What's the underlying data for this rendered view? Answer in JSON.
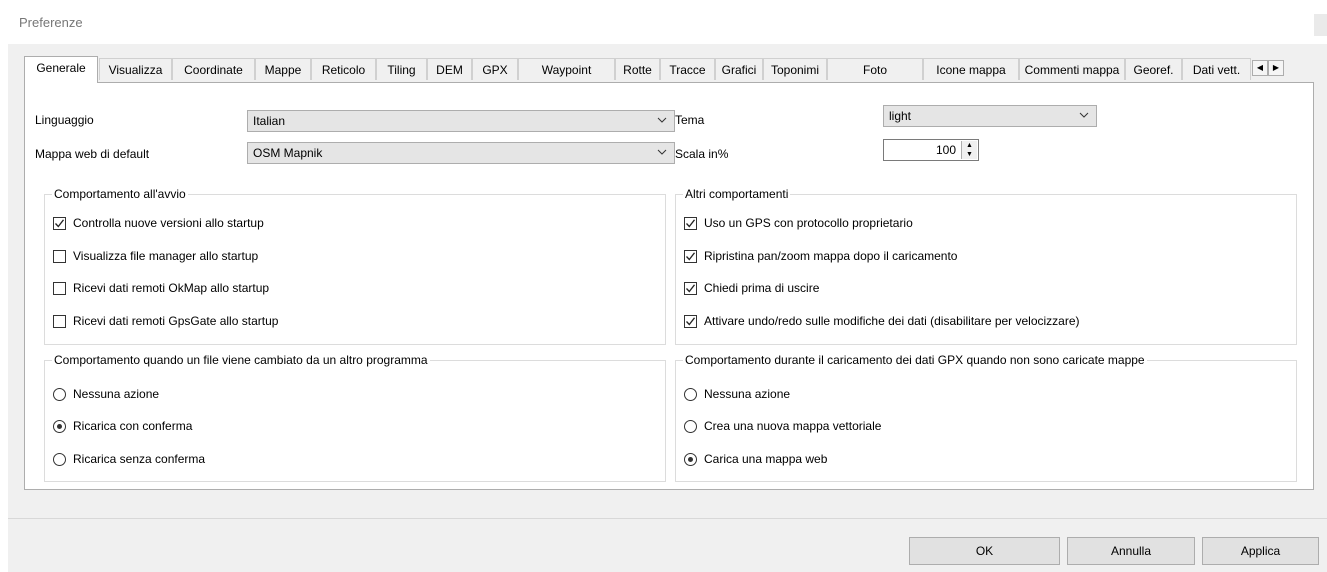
{
  "window": {
    "title": "Preferenze"
  },
  "tabs": [
    {
      "label": "Generale",
      "active": true
    },
    {
      "label": "Visualizza"
    },
    {
      "label": "Coordinate"
    },
    {
      "label": "Mappe"
    },
    {
      "label": "Reticolo"
    },
    {
      "label": "Tiling"
    },
    {
      "label": "DEM"
    },
    {
      "label": "GPX"
    },
    {
      "label": "Waypoint"
    },
    {
      "label": "Rotte"
    },
    {
      "label": "Tracce"
    },
    {
      "label": "Grafici"
    },
    {
      "label": "Toponimi"
    },
    {
      "label": "Foto"
    },
    {
      "label": "Icone mappa"
    },
    {
      "label": "Commenti mappa"
    },
    {
      "label": "Georef."
    },
    {
      "label": "Dati vett."
    }
  ],
  "tab_scroll": {
    "left": "◀",
    "right": "▶"
  },
  "general": {
    "language_label": "Linguaggio",
    "language_value": "Italian",
    "webmap_label": "Mappa web di default",
    "webmap_value": "OSM Mapnik",
    "theme_label": "Tema",
    "theme_value": "light",
    "scale_label": "Scala in%",
    "scale_value": "100"
  },
  "startup_group": {
    "legend": "Comportamento all'avvio",
    "options": [
      {
        "label": "Controlla nuove versioni allo startup",
        "checked": true
      },
      {
        "label": "Visualizza file manager allo startup",
        "checked": false
      },
      {
        "label": "Ricevi dati remoti OkMap allo startup",
        "checked": false
      },
      {
        "label": "Ricevi dati remoti GpsGate allo startup",
        "checked": false
      }
    ]
  },
  "other_group": {
    "legend": "Altri comportamenti",
    "options": [
      {
        "label": "Uso un GPS con protocollo proprietario",
        "checked": true
      },
      {
        "label": "Ripristina pan/zoom mappa dopo il caricamento",
        "checked": true
      },
      {
        "label": "Chiedi prima di uscire",
        "checked": true
      },
      {
        "label": "Attivare undo/redo sulle modifiche dei dati (disabilitare per velocizzare)",
        "checked": true
      }
    ]
  },
  "filechange_group": {
    "legend": "Comportamento quando un file viene cambiato da un altro programma",
    "options": [
      {
        "label": "Nessuna azione",
        "selected": false
      },
      {
        "label": "Ricarica con conferma",
        "selected": true
      },
      {
        "label": "Ricarica senza conferma",
        "selected": false
      }
    ]
  },
  "gpx_group": {
    "legend": "Comportamento durante il caricamento dei dati GPX quando non sono caricate mappe",
    "options": [
      {
        "label": "Nessuna azione",
        "selected": false
      },
      {
        "label": "Crea una nuova mappa vettoriale",
        "selected": false
      },
      {
        "label": "Carica una mappa web",
        "selected": true
      }
    ]
  },
  "buttons": {
    "ok": "OK",
    "cancel": "Annulla",
    "apply": "Applica"
  },
  "icons": {
    "dropdown": "chevron-down-icon",
    "check": "checkmark-icon"
  },
  "colors": {
    "panel_bg": "#ffffff",
    "dialog_bg": "#f0f0f0",
    "combo_bg": "#e5e5e5"
  }
}
